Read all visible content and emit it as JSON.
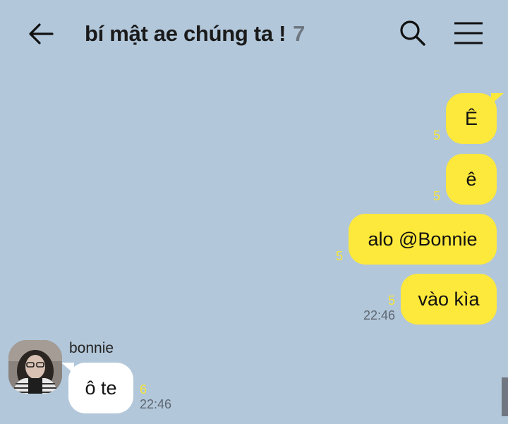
{
  "header": {
    "back_icon": "arrow-left-icon",
    "title": "bí mật ae chúng ta !",
    "member_count": "7",
    "search_icon": "search-icon",
    "menu_icon": "hamburger-menu-icon"
  },
  "messages_out": [
    {
      "text": "Ê",
      "unread": "5",
      "time": ""
    },
    {
      "text": "ê",
      "unread": "5",
      "time": ""
    },
    {
      "text": "alo @Bonnie",
      "unread": "5",
      "time": ""
    },
    {
      "text": "vào kìa",
      "unread": "5",
      "time": "22:46"
    }
  ],
  "message_in": {
    "sender": "bonnie",
    "text": "ô te",
    "unread": "6",
    "time": "22:46"
  },
  "colors": {
    "background": "#b2c7da",
    "outgoing_bubble": "#fde83c",
    "incoming_bubble": "#ffffff",
    "unread": "#f4e53a"
  }
}
